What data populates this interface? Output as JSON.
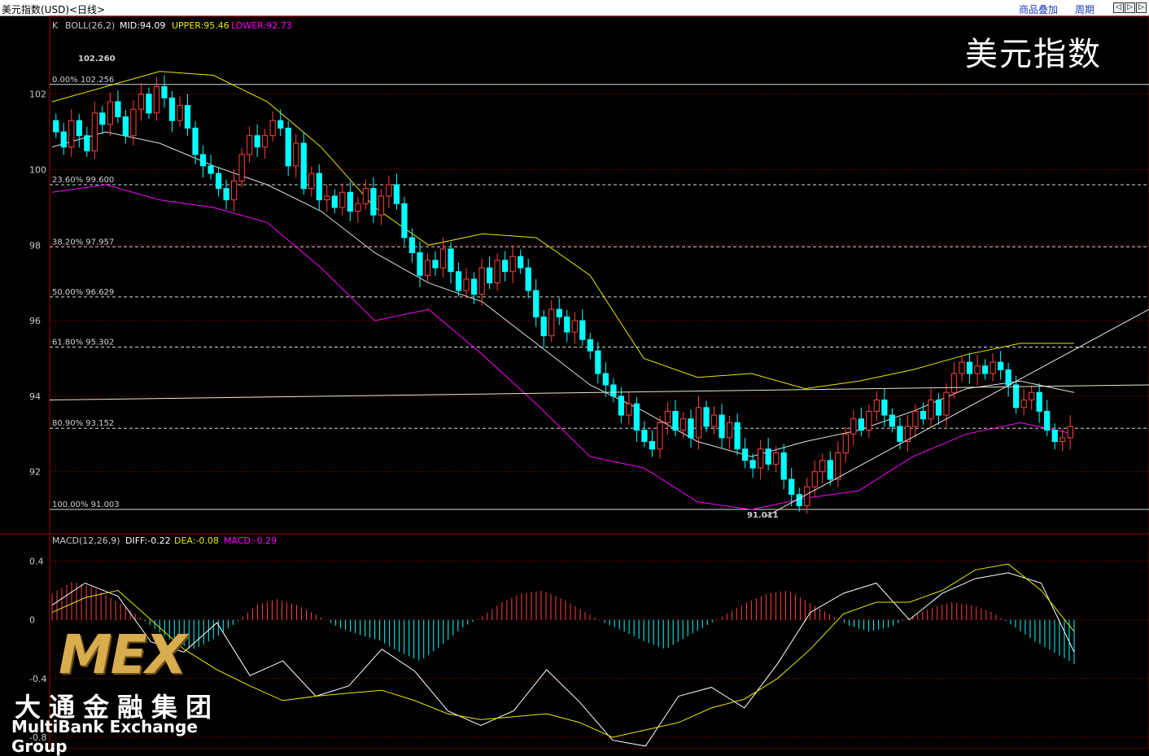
{
  "titlebar": {
    "title": "美元指数(USD)<日线>",
    "overlay_link": "商品叠加",
    "period_link": "周期",
    "nav_left": "◁",
    "nav_right": "▷"
  },
  "main_header": {
    "k": "K",
    "boll": "BOLL(26,2)",
    "mid": "MID:94.09",
    "upper": "UPPER:95.46",
    "lower": "LOWER:92.73"
  },
  "big_title": "美元指数",
  "macd_header": {
    "macd": "MACD(12,26,9)",
    "diff": "DIFF:-0.22",
    "dea": "DEA:-0.08",
    "value": "MACD:-0.29"
  },
  "markers": {
    "high": "102.260",
    "low": "91.011"
  },
  "logo": {
    "mex": "MEX",
    "cn": "大通金融集团",
    "en": "MultiBank Exchange Group"
  },
  "colors": {
    "up": "#ff4040",
    "down": "#00ffff",
    "upper": "#e8e800",
    "lower": "#ff00ff",
    "mid": "#e0e0e0",
    "grid": "#a00000"
  },
  "chart_data": [
    {
      "type": "candlestick",
      "title": "美元指数",
      "y_ticks": [
        "102",
        "100",
        "98",
        "96",
        "94",
        "92"
      ],
      "ylim": [
        90.7,
        103.2
      ],
      "fib_levels": [
        {
          "label": "0.00% 102.256",
          "value": 102.256
        },
        {
          "label": "23.60% 99.600",
          "value": 99.6
        },
        {
          "label": "38.20% 97.957",
          "value": 97.957
        },
        {
          "label": "50.00% 96.629",
          "value": 96.629
        },
        {
          "label": "61.80% 95.302",
          "value": 95.302
        },
        {
          "label": "80.90% 93.152",
          "value": 93.152
        },
        {
          "label": "100.00% 91.003",
          "value": 91.003
        }
      ],
      "series_close": [
        101.0,
        100.6,
        101.3,
        100.9,
        100.5,
        101.5,
        101.2,
        101.8,
        101.4,
        100.9,
        101.6,
        102.0,
        101.5,
        102.2,
        101.9,
        101.3,
        101.7,
        101.1,
        100.4,
        100.1,
        99.9,
        99.5,
        99.2,
        99.7,
        100.4,
        100.9,
        100.6,
        100.9,
        101.3,
        101.1,
        100.1,
        100.7,
        99.5,
        99.9,
        99.2,
        99.3,
        99.0,
        99.4,
        98.9,
        99.1,
        99.5,
        98.8,
        99.3,
        99.6,
        99.1,
        98.2,
        97.8,
        97.2,
        97.6,
        97.4,
        97.9,
        97.3,
        96.8,
        97.1,
        96.7,
        97.4,
        97.0,
        97.6,
        97.3,
        97.7,
        97.4,
        96.8,
        96.1,
        95.6,
        96.3,
        96.1,
        95.7,
        96.0,
        95.5,
        95.2,
        94.6,
        94.3,
        94.0,
        93.5,
        93.8,
        93.1,
        92.8,
        92.6,
        93.3,
        93.6,
        93.1,
        93.4,
        92.9,
        93.7,
        93.2,
        93.5,
        92.9,
        93.3,
        92.6,
        92.3,
        92.1,
        92.6,
        92.2,
        92.5,
        91.8,
        91.4,
        91.1,
        91.6,
        92.0,
        92.3,
        91.8,
        92.5,
        93.0,
        93.4,
        93.1,
        93.6,
        93.9,
        93.5,
        93.2,
        92.8,
        93.2,
        93.6,
        93.4,
        93.9,
        93.5,
        94.1,
        94.6,
        94.9,
        94.6,
        94.8,
        94.6,
        94.9,
        94.7,
        94.3,
        93.7,
        93.9,
        94.1,
        93.6,
        93.1,
        92.8,
        92.9,
        93.2
      ],
      "upper_band_samples": [
        101.8,
        102.2,
        102.6,
        102.5,
        101.8,
        100.6,
        99.0,
        98.0,
        98.3,
        98.2,
        97.2,
        95.0,
        94.5,
        94.6,
        94.2,
        94.4,
        94.7,
        95.1,
        95.4,
        95.4
      ],
      "mid_band_samples": [
        100.6,
        101.0,
        100.7,
        100.1,
        99.6,
        98.9,
        97.8,
        97.0,
        96.5,
        95.4,
        94.3,
        93.6,
        92.8,
        92.4,
        92.8,
        93.1,
        93.6,
        94.2,
        94.4,
        94.1
      ],
      "lower_band_samples": [
        99.4,
        99.6,
        99.2,
        99.0,
        98.6,
        97.4,
        96.0,
        96.3,
        95.1,
        93.8,
        92.4,
        92.1,
        91.2,
        91.0,
        91.3,
        91.5,
        92.4,
        93.0,
        93.3,
        93.0
      ],
      "trendlines": [
        {
          "name": "support",
          "from": [
            91.0,
            "start"
          ],
          "to": [
            96.3,
            "end"
          ]
        },
        {
          "name": "horizontal",
          "value": 93.9
        }
      ]
    },
    {
      "type": "bar",
      "title": "MACD(12,26,9)",
      "y_ticks": [
        "0.4",
        "0",
        "-0.4",
        "-0.8"
      ],
      "ylim": [
        -0.85,
        0.48
      ],
      "macd_hist": [
        0.18,
        0.26,
        0.22,
        0.14,
        0.05,
        -0.06,
        -0.16,
        -0.2,
        -0.12,
        -0.02,
        0.1,
        0.14,
        0.1,
        0.03,
        -0.05,
        -0.1,
        -0.14,
        -0.22,
        -0.28,
        -0.18,
        -0.06,
        0.02,
        0.12,
        0.18,
        0.2,
        0.14,
        0.06,
        -0.02,
        -0.08,
        -0.15,
        -0.2,
        -0.12,
        -0.04,
        0.04,
        0.12,
        0.18,
        0.2,
        0.12,
        0.04,
        -0.04,
        -0.08,
        -0.05,
        0.02,
        0.08,
        0.12,
        0.1,
        0.05,
        -0.04,
        -0.14,
        -0.22,
        -0.3
      ],
      "diff_line": [
        0.1,
        0.25,
        0.16,
        -0.15,
        -0.22,
        -0.02,
        -0.38,
        -0.28,
        -0.52,
        -0.45,
        -0.2,
        -0.35,
        -0.62,
        -0.72,
        -0.62,
        -0.34,
        -0.56,
        -0.82,
        -0.86,
        -0.52,
        -0.46,
        -0.6,
        -0.3,
        0.05,
        0.18,
        0.25,
        0.0,
        0.18,
        0.28,
        0.32,
        0.25,
        -0.22
      ],
      "dea_line": [
        0.05,
        0.15,
        0.2,
        0.0,
        -0.2,
        -0.34,
        -0.45,
        -0.55,
        -0.52,
        -0.5,
        -0.48,
        -0.55,
        -0.64,
        -0.68,
        -0.66,
        -0.64,
        -0.7,
        -0.8,
        -0.75,
        -0.7,
        -0.6,
        -0.54,
        -0.4,
        -0.2,
        0.04,
        0.12,
        0.12,
        0.2,
        0.34,
        0.38,
        0.2,
        -0.08
      ]
    }
  ]
}
